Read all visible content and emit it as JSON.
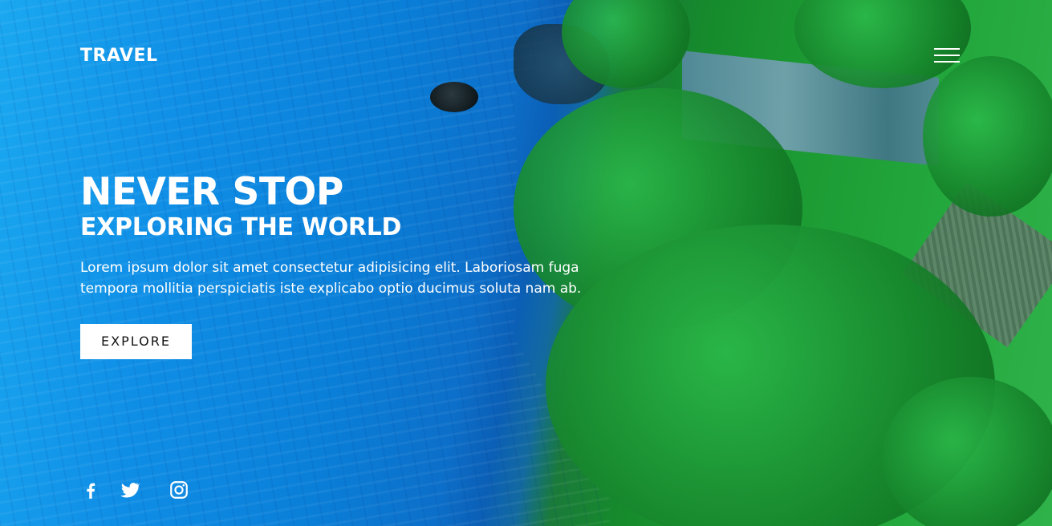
{
  "brand": {
    "logo_text": "TRAVEL"
  },
  "nav": {
    "menu_icon": "hamburger-menu-icon"
  },
  "hero": {
    "headline": "NEVER STOP",
    "subheadline": "EXPLORING THE WORLD",
    "description": "Lorem ipsum dolor sit amet consectetur adipisicing elit. Laboriosam fuga tempora mollitia perspiciatis iste explicabo optio ducimus soluta nam ab.",
    "cta_label": "EXPLORE"
  },
  "social": {
    "items": [
      {
        "icon": "facebook-icon"
      },
      {
        "icon": "twitter-icon"
      },
      {
        "icon": "instagram-icon"
      }
    ]
  },
  "colors": {
    "text": "#ffffff",
    "button_bg": "#ffffff",
    "button_text": "#111111",
    "water": "#0f8ee6",
    "foliage": "#1c9a33"
  }
}
